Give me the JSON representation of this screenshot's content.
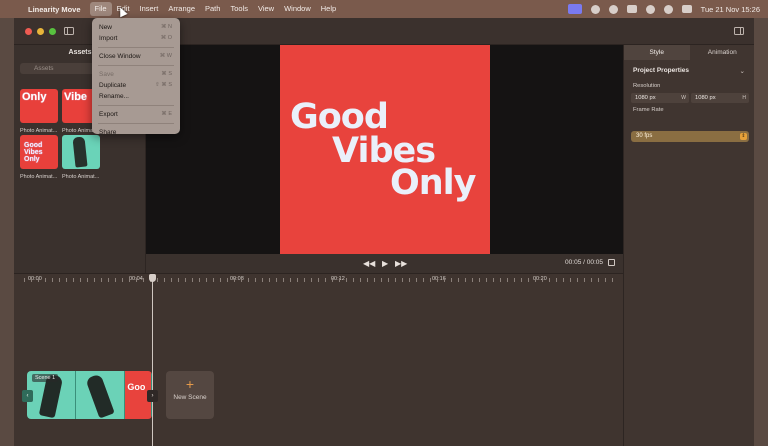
{
  "menubar": {
    "app_name": "Linearity Move",
    "menus": [
      "File",
      "Edit",
      "Insert",
      "Arrange",
      "Path",
      "Tools",
      "View",
      "Window",
      "Help"
    ],
    "active_menu": "File",
    "clock": "Tue 21 Nov  15:26"
  },
  "file_menu": {
    "new": {
      "label": "New",
      "shortcut": "⌘ N"
    },
    "import": {
      "label": "Import",
      "shortcut": "⌘ O"
    },
    "close_window": {
      "label": "Close Window",
      "shortcut": "⌘ W"
    },
    "save": {
      "label": "Save",
      "shortcut": "⌘ S"
    },
    "duplicate": {
      "label": "Duplicate",
      "shortcut": "⇧ ⌘ S"
    },
    "rename": {
      "label": "Rename..."
    },
    "export": {
      "label": "Export",
      "shortcut": "⌘ E"
    },
    "share": {
      "label": "Share"
    }
  },
  "assets": {
    "title": "Assets",
    "search_placeholder": "Assets",
    "items": [
      {
        "caption": "Photo Animat...",
        "thumb_text": "Only"
      },
      {
        "caption": "Photo Anima...",
        "thumb_text": "Vibe"
      },
      {
        "caption": "Photo Animat...",
        "thumb_text": "Good Vibes Only"
      },
      {
        "caption": "Photo Animat..."
      }
    ]
  },
  "canvas": {
    "line1": "Good",
    "line2": "Vibes",
    "line3": "Only"
  },
  "transport": {
    "rewind": "◀◀",
    "play": "▶",
    "forward": "▶▶",
    "time": "00:05 / 00:05"
  },
  "inspector": {
    "tabs": [
      "Style",
      "Animation"
    ],
    "section_title": "Project Properties",
    "resolution_label": "Resolution",
    "width_value": "1080 px",
    "width_unit": "W",
    "height_value": "1080 px",
    "height_unit": "H",
    "frame_rate_label": "Frame Rate",
    "frame_rate_value": "30 fps"
  },
  "timeline": {
    "ruler_labels": [
      "00:00",
      "00:04",
      "00:08",
      "00:12",
      "00:16",
      "00:20"
    ],
    "scene_label": "Scene 1",
    "clip_thumb_text": "Goo",
    "new_scene_label": "New Scene"
  },
  "colors": {
    "accent": "#e6a13a",
    "artboard": "#e8433d",
    "menu_highlight": "#7a7af0"
  }
}
